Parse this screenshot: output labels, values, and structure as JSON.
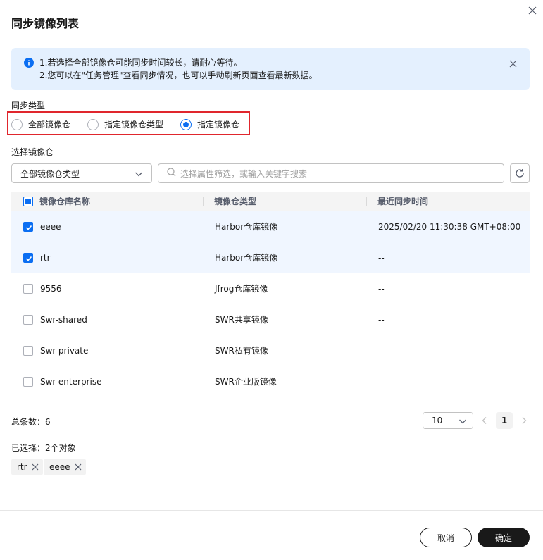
{
  "dialog": {
    "title": "同步镜像列表"
  },
  "alert": {
    "line1": "1.若选择全部镜像仓可能同步时间较长，请耐心等待。",
    "line2": "2.您可以在\"任务管理\"查看同步情况，也可以手动刷新页面查看最新数据。"
  },
  "sync_type": {
    "label": "同步类型",
    "options": [
      {
        "label": "全部镜像仓",
        "selected": false
      },
      {
        "label": "指定镜像仓类型",
        "selected": false
      },
      {
        "label": "指定镜像仓",
        "selected": true
      }
    ]
  },
  "select_repo": {
    "label": "选择镜像仓",
    "type_filter": "全部镜像仓类型",
    "search_placeholder": "选择属性筛选，或输入关键字搜索"
  },
  "table": {
    "columns": [
      "镜像仓库名称",
      "镜像仓类型",
      "最近同步时间"
    ],
    "rows": [
      {
        "name": "eeee",
        "type": "Harbor仓库镜像",
        "time": "2025/02/20 11:30:38 GMT+08:00",
        "checked": true
      },
      {
        "name": "rtr",
        "type": "Harbor仓库镜像",
        "time": "--",
        "checked": true
      },
      {
        "name": "9556",
        "type": "Jfrog仓库镜像",
        "time": "--",
        "checked": false
      },
      {
        "name": "Swr-shared",
        "type": "SWR共享镜像",
        "time": "--",
        "checked": false
      },
      {
        "name": "Swr-private",
        "type": "SWR私有镜像",
        "time": "--",
        "checked": false
      },
      {
        "name": "Swr-enterprise",
        "type": "SWR企业版镜像",
        "time": "--",
        "checked": false
      }
    ]
  },
  "pagination": {
    "total": "总条数：6",
    "page_size": "10",
    "current_page": "1"
  },
  "selection": {
    "label": "已选择：2个对象",
    "tags": [
      "rtr",
      "eeee"
    ]
  },
  "footer": {
    "cancel": "取消",
    "confirm": "确定"
  },
  "colors": {
    "primary": "#0b6ef2",
    "alert_bg": "#e4f0fe",
    "highlight_border": "#e0262d",
    "confirm_bg": "#191919"
  }
}
